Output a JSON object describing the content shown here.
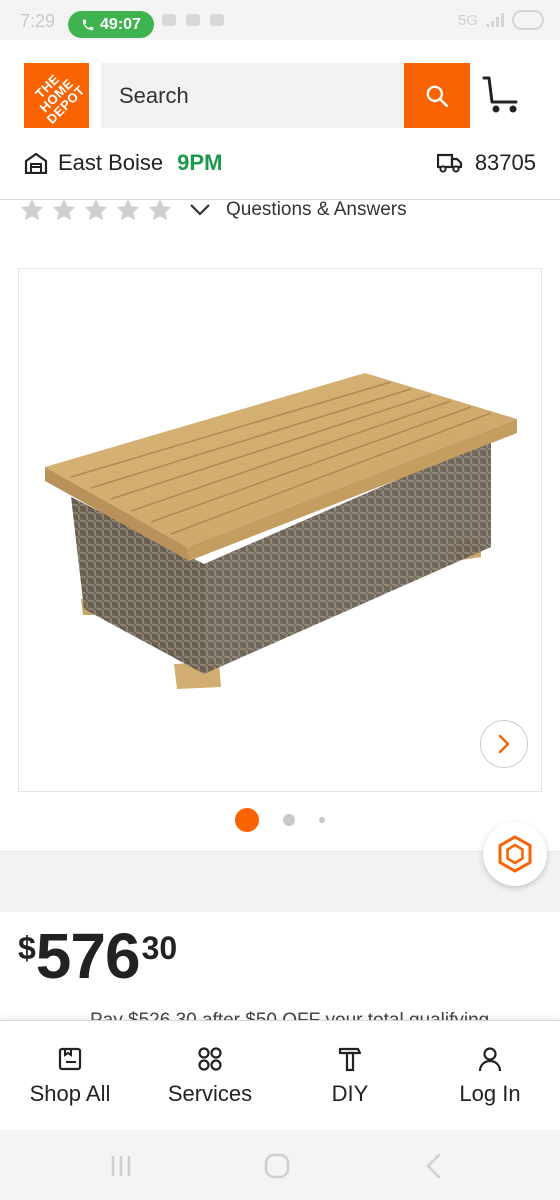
{
  "status_bar": {
    "time": "7:29",
    "call_timer": "49:07",
    "network": "5G"
  },
  "header": {
    "logo_text": "THE HOME DEPOT",
    "search_placeholder": "Search",
    "store_name": "East Boise",
    "store_hours": "9PM",
    "zip_code": "83705"
  },
  "product": {
    "rating_stars": 5,
    "qa_link": "Questions & Answers",
    "image_alt": "Wicker and teak outdoor coffee table",
    "carousel": {
      "total_images": 3,
      "active_index": 0
    },
    "price": {
      "currency": "$",
      "dollars": "576",
      "cents": "30"
    },
    "promo_text": "Pay $526.30 after $50 OFF your total qualifying"
  },
  "bottom_nav": {
    "items": [
      {
        "label": "Shop All",
        "icon": "shop-all-icon"
      },
      {
        "label": "Services",
        "icon": "services-icon"
      },
      {
        "label": "DIY",
        "icon": "diy-icon"
      },
      {
        "label": "Log In",
        "icon": "user-icon"
      }
    ]
  },
  "colors": {
    "brand_orange": "#f96302",
    "store_green": "#1a9b4b",
    "call_green": "#3fb34f"
  }
}
